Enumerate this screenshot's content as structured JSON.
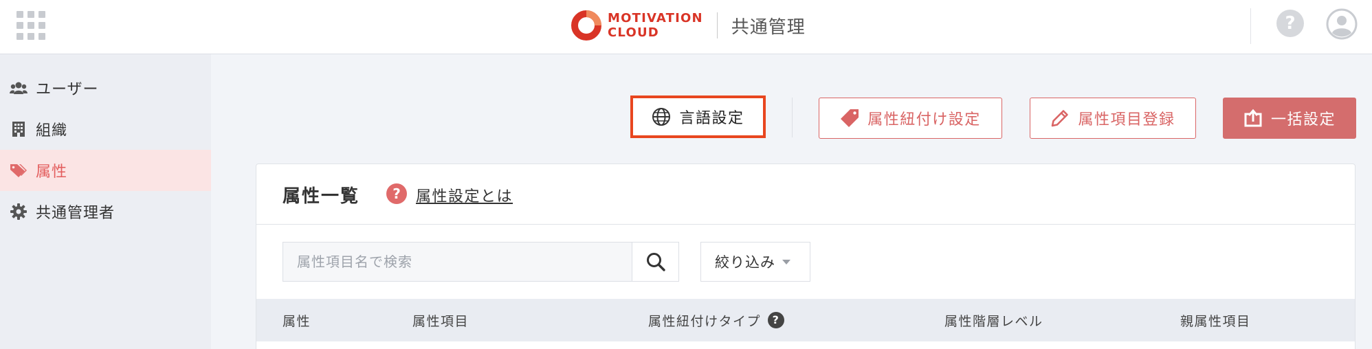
{
  "header": {
    "brand_line1": "MOTIVATION",
    "brand_line2": "CLOUD",
    "product": "共通管理",
    "help_icon": "?"
  },
  "sidebar": {
    "items": [
      {
        "label": "ユーザー",
        "icon": "users-icon",
        "active": false
      },
      {
        "label": "組織",
        "icon": "building-icon",
        "active": false
      },
      {
        "label": "属性",
        "icon": "tags-icon",
        "active": true
      },
      {
        "label": "共通管理者",
        "icon": "gear-icon",
        "active": false
      }
    ]
  },
  "toolbar": {
    "language_label": "言語設定",
    "tag_link_label": "属性紐付け設定",
    "register_label": "属性項目登録",
    "bulk_label": "一括設定"
  },
  "card": {
    "title": "属性一覧",
    "help_icon": "?",
    "help_link": "属性設定とは",
    "search_placeholder": "属性項目名で検索",
    "filter_label": "絞り込み"
  },
  "table": {
    "columns": [
      {
        "label": "属性"
      },
      {
        "label": "属性項目"
      },
      {
        "label": "属性紐付けタイプ",
        "help": "?"
      },
      {
        "label": "属性階層レベル"
      },
      {
        "label": "親属性項目"
      }
    ]
  },
  "colors": {
    "brand_red": "#d93426",
    "accent": "#d96464",
    "accent_fill": "#d46d6d",
    "highlight_border": "#e8461f",
    "sidebar_active_bg": "#fbe4e4"
  }
}
